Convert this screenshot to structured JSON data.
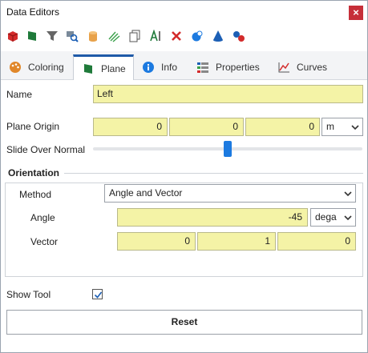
{
  "window": {
    "title": "Data Editors",
    "close_glyph": "×",
    "accent": "#1f5aa8",
    "field_color": "#f4f3a6"
  },
  "toolbar": {
    "icons": [
      "red-cube-icon",
      "green-flag-icon",
      "filter-icon",
      "search-zoom-icon",
      "cylinder-icon",
      "lines-icon",
      "copy-document-icon",
      "text-cursor-icon",
      "delete-x-icon",
      "sphere-plane-icon",
      "cone-icon",
      "molecule-icon"
    ]
  },
  "tabs": [
    {
      "label": "Coloring",
      "icon": "palette-icon",
      "active": false
    },
    {
      "label": "Plane",
      "icon": "plane-flag-icon",
      "active": true
    },
    {
      "label": "Info",
      "icon": "info-icon",
      "active": false
    },
    {
      "label": "Properties",
      "icon": "properties-grid-icon",
      "active": false
    },
    {
      "label": "Curves",
      "icon": "chart-curve-icon",
      "active": false
    }
  ],
  "form": {
    "name_label": "Name",
    "name_value": "Left",
    "plane_origin_label": "Plane Origin",
    "plane_origin_values": [
      "0",
      "0",
      "0"
    ],
    "plane_origin_unit": "m",
    "slide_label": "Slide Over Normal",
    "slide_position": 0.5,
    "orientation_title": "Orientation",
    "method_label": "Method",
    "method_value": "Angle and Vector",
    "angle_label": "Angle",
    "angle_value": "-45",
    "angle_unit": "dega",
    "vector_label": "Vector",
    "vector_values": [
      "0",
      "1",
      "0"
    ],
    "show_tool_label": "Show Tool",
    "show_tool_checked": true,
    "reset_label": "Reset"
  }
}
